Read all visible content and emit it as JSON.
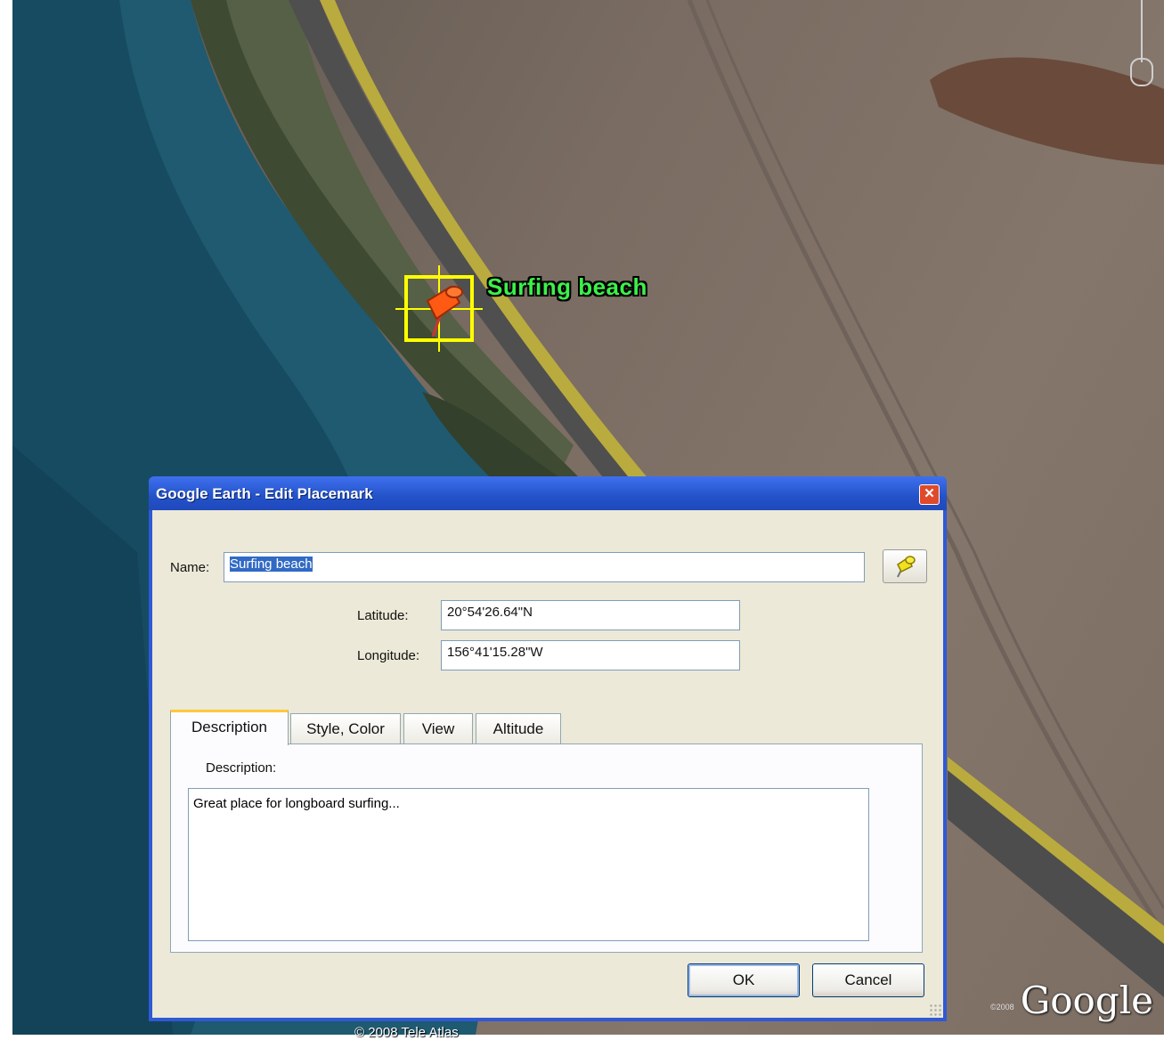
{
  "map": {
    "placemark_label": "Surfing beach",
    "copyright": "© 2008 Tele Atlas",
    "logo": "Google",
    "logo_year": "©2008"
  },
  "dialog": {
    "title": "Google Earth - Edit Placemark",
    "close_glyph": "✕",
    "name_label": "Name:",
    "name_value": "Surfing beach",
    "latitude_label": "Latitude:",
    "latitude_value": "20°54'26.64\"N",
    "longitude_label": "Longitude:",
    "longitude_value": "156°41'15.28\"W",
    "tabs": [
      "Description",
      "Style, Color",
      "View",
      "Altitude"
    ],
    "description_label": "Description:",
    "description_value": "Great place for longboard surfing...",
    "ok_label": "OK",
    "cancel_label": "Cancel"
  },
  "colors": {
    "title_bar": "#2352c8",
    "placemark_label": "#3cf04a",
    "pin": "#ff5a14",
    "selection": "#ffff00"
  }
}
